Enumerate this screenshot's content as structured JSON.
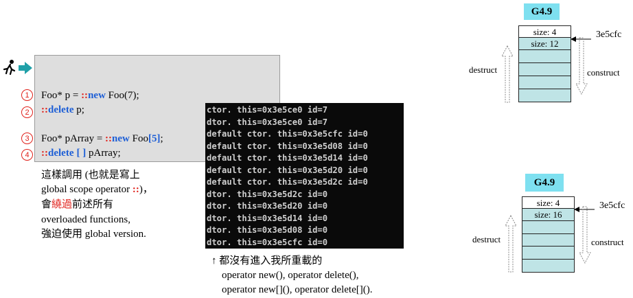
{
  "code": {
    "lines": [
      {
        "num": "1",
        "pre": "Foo* p = ",
        "op": "::",
        "kw": "new",
        "post": " Foo(7);"
      },
      {
        "num": "2",
        "op": "::",
        "kw": "delete",
        "post": " p;"
      },
      {
        "num": "3",
        "pre": "Foo* pArray = ",
        "op": "::",
        "kw": "new",
        "post": " Foo",
        "bracket": "[5]",
        "tail": ";"
      },
      {
        "num": "4",
        "op": "::",
        "kw": "delete",
        "bracket": "[ ]",
        "post": " pArray;"
      }
    ]
  },
  "explanation": {
    "line1": "這樣調用 (也就是寫上",
    "line2_pre": "global scope operator ",
    "line2_op": "::",
    "line2_post": ")，",
    "line3_pre": "會",
    "line3_red": "繞過",
    "line3_post": "前述所有",
    "line4": "overloaded functions,",
    "line5": "強迫使用 global version."
  },
  "console": {
    "lines": [
      "ctor. this=0x3e5ce0 id=7",
      "dtor. this=0x3e5ce0 id=7",
      "default ctor. this=0x3e5cfc id=0",
      "default ctor. this=0x3e5d08 id=0",
      "default ctor. this=0x3e5d14 id=0",
      "default ctor. this=0x3e5d20 id=0",
      "default ctor. this=0x3e5d2c id=0",
      "dtor. this=0x3e5d2c id=0",
      "dtor. this=0x3e5d20 id=0",
      "dtor. this=0x3e5d14 id=0",
      "dtor. this=0x3e5d08 id=0",
      "dtor. this=0x3e5cfc id=0"
    ]
  },
  "note": {
    "line1": "↑  都沒有進入我所重載的",
    "line2": "operator new(), operator delete(),",
    "line3": "operator new[](), operator delete[]()."
  },
  "diagrams": [
    {
      "title": "G4.9",
      "size_header": "size: 4",
      "size_count": "size: 12",
      "address": "3e5cfc",
      "destruct": "destruct",
      "construct": "construct"
    },
    {
      "title": "G4.9",
      "size_header": "size: 4",
      "size_count": "size: 16",
      "address": "3e5cfc",
      "destruct": "destruct",
      "construct": "construct"
    }
  ],
  "colors": {
    "keyword_red": "#e0201a",
    "keyword_blue": "#1e5fd6",
    "title_cyan": "#7ee0f0",
    "cell_fill": "#bfe4e6"
  }
}
